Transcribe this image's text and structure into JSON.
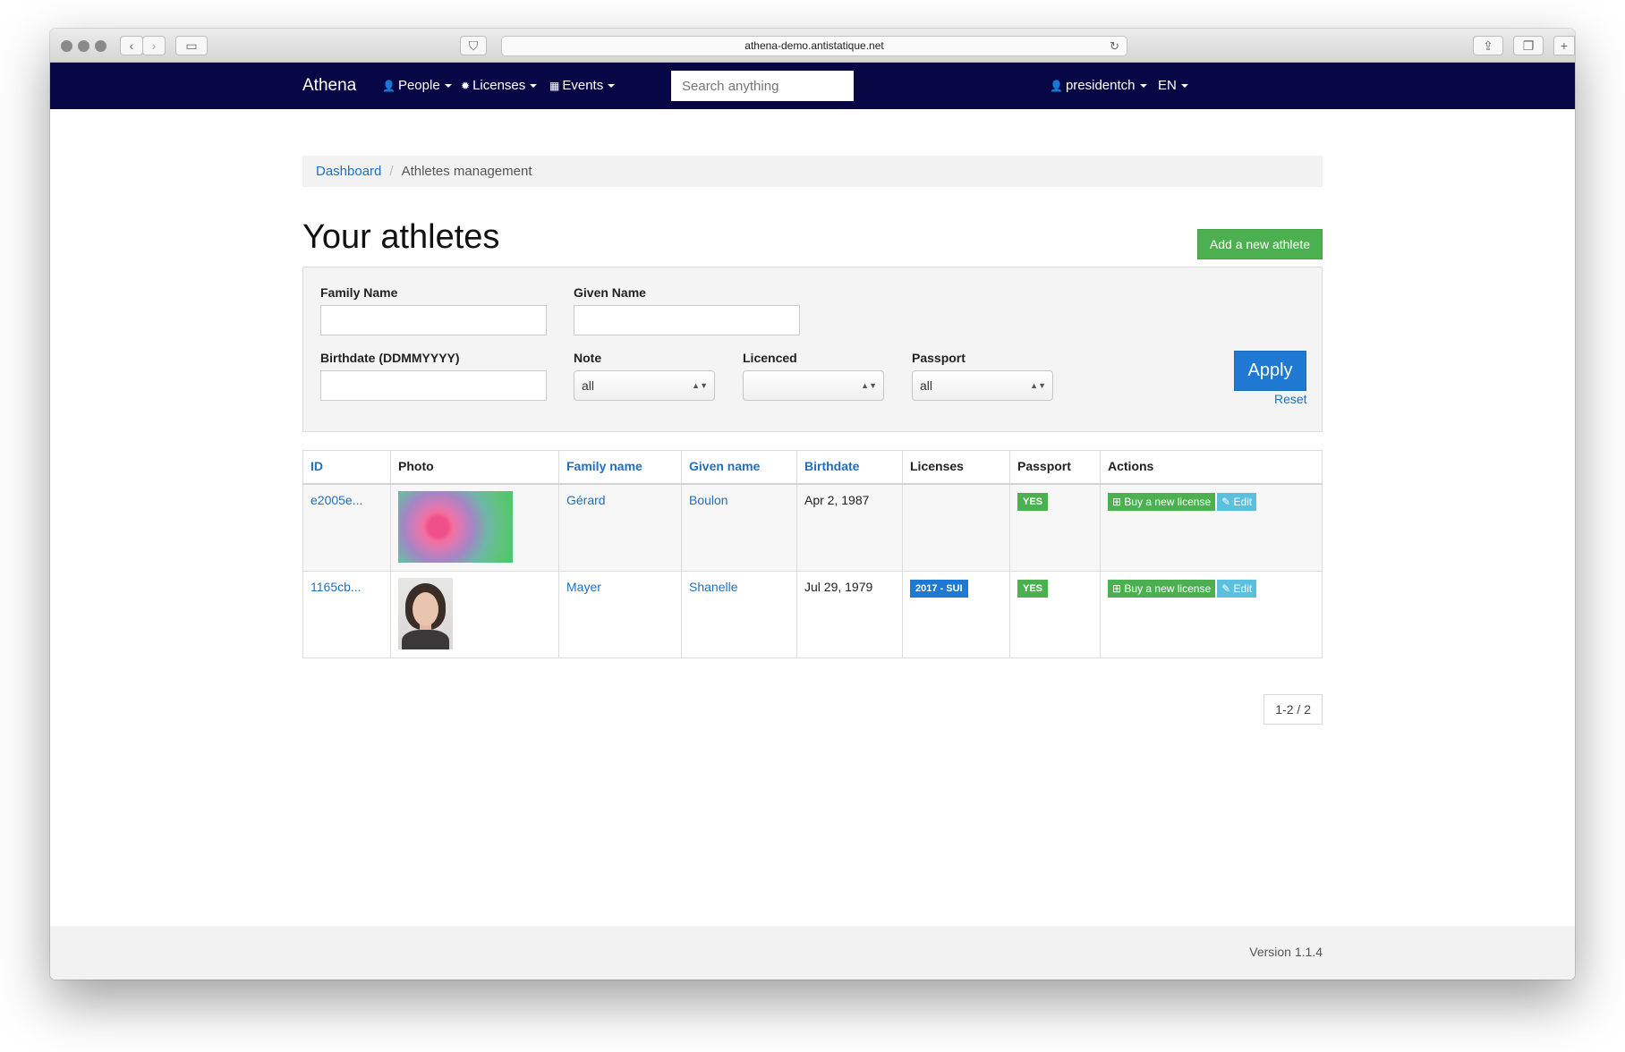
{
  "browser": {
    "url": "athena-demo.antistatique.net"
  },
  "navbar": {
    "brand": "Athena",
    "people": "People",
    "licenses": "Licenses",
    "events": "Events",
    "search_placeholder": "Search anything",
    "user": "presidentch",
    "language": "EN"
  },
  "breadcrumb": {
    "home": "Dashboard",
    "current": "Athletes management"
  },
  "page": {
    "title": "Your athletes",
    "add_button": "Add a new athlete"
  },
  "filters": {
    "family_name_label": "Family Name",
    "given_name_label": "Given Name",
    "birthdate_label": "Birthdate (DDMMYYYY)",
    "note_label": "Note",
    "note_value": "all",
    "licenced_label": "Licenced",
    "licenced_value": "",
    "passport_label": "Passport",
    "passport_value": "all",
    "apply": "Apply",
    "reset": "Reset"
  },
  "table": {
    "headers": [
      "ID",
      "Photo",
      "Family name",
      "Given name",
      "Birthdate",
      "Licenses",
      "Passport",
      "Actions"
    ],
    "rows": [
      {
        "id": "e2005e...",
        "family_name": "Gérard",
        "given_name": "Boulon",
        "birthdate": "Apr 2, 1987",
        "license": "",
        "passport": "YES",
        "buy": "Buy a new license",
        "edit": "Edit"
      },
      {
        "id": "1165cb...",
        "family_name": "Mayer",
        "given_name": "Shanelle",
        "birthdate": "Jul 29, 1979",
        "license": "2017 - SUI",
        "passport": "YES",
        "buy": "Buy a new license",
        "edit": "Edit"
      }
    ]
  },
  "pagination": "1-2 / 2",
  "footer": {
    "version": "Version 1.1.4"
  }
}
